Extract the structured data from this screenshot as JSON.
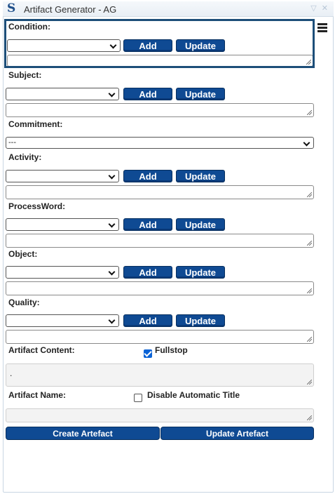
{
  "window": {
    "title": "Artifact Generator - AG",
    "logo": "S",
    "controls": "▽ ✕"
  },
  "labels": {
    "condition": "Condition:",
    "subject": "Subject:",
    "commitment": "Commitment:",
    "activity": "Activity:",
    "processword": "ProcessWord:",
    "object": "Object:",
    "quality": "Quality:",
    "artifact_content": "Artifact Content:",
    "artifact_name": "Artifact Name:"
  },
  "buttons": {
    "add": "Add",
    "update": "Update",
    "create_artefact": "Create Artefact",
    "update_artefact": "Update Artefact"
  },
  "commitment": {
    "selected": "---"
  },
  "artifact_content": {
    "value": "."
  },
  "checkboxes": {
    "fullstop": {
      "label": "Fullstop",
      "checked": true
    },
    "disable_auto_title": {
      "label": "Disable Automatic Title",
      "checked": false
    }
  },
  "colors": {
    "accent": "#0f4a93",
    "highlight_border": "#1d4e79"
  }
}
